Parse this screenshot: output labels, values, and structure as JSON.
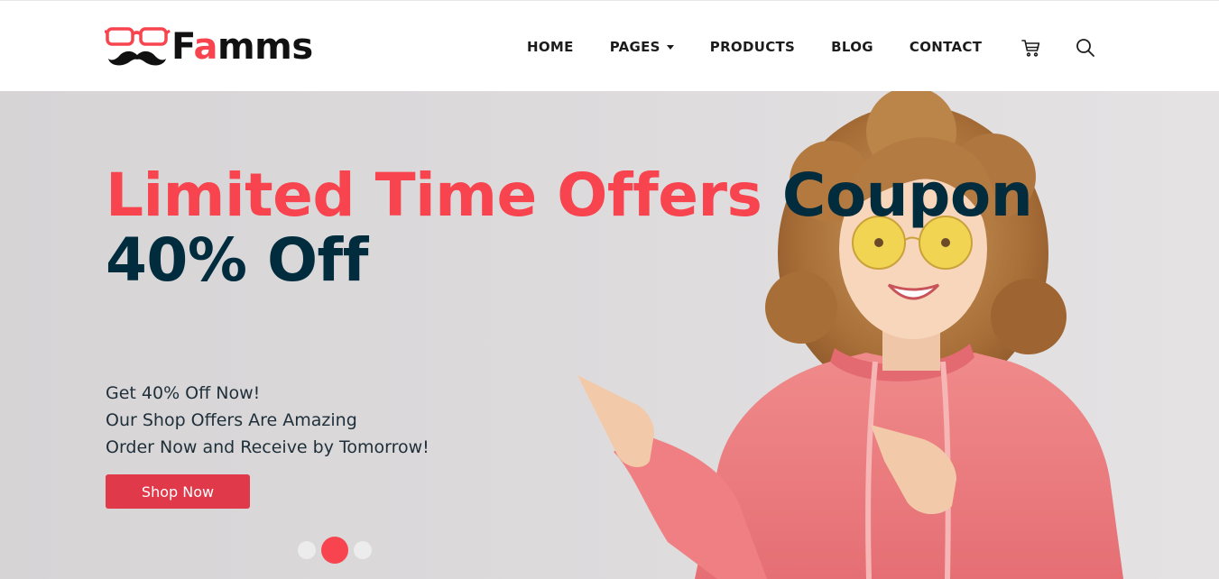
{
  "brand": {
    "name_prefix": "F",
    "name_accent": "a",
    "name_suffix": "mms",
    "accent_color": "#f7444e",
    "dark_color": "#002c3e"
  },
  "nav": {
    "home": "HOME",
    "pages": "PAGES",
    "products": "PRODUCTS",
    "blog": "BLOG",
    "contact": "CONTACT",
    "icons": [
      "cart-icon",
      "search-icon"
    ]
  },
  "hero": {
    "headline_red": "Limited Time Offers",
    "headline_dark_1": "Coupon",
    "headline_dark_2": "40% Off",
    "lines": [
      "Get 40% Off Now!",
      "Our Shop Offers Are Amazing",
      "Order Now and Receive by Tomorrow!"
    ],
    "button_label": "Shop Now",
    "button_color": "#e0394a",
    "slider": {
      "total": 3,
      "active_index": 1
    }
  }
}
